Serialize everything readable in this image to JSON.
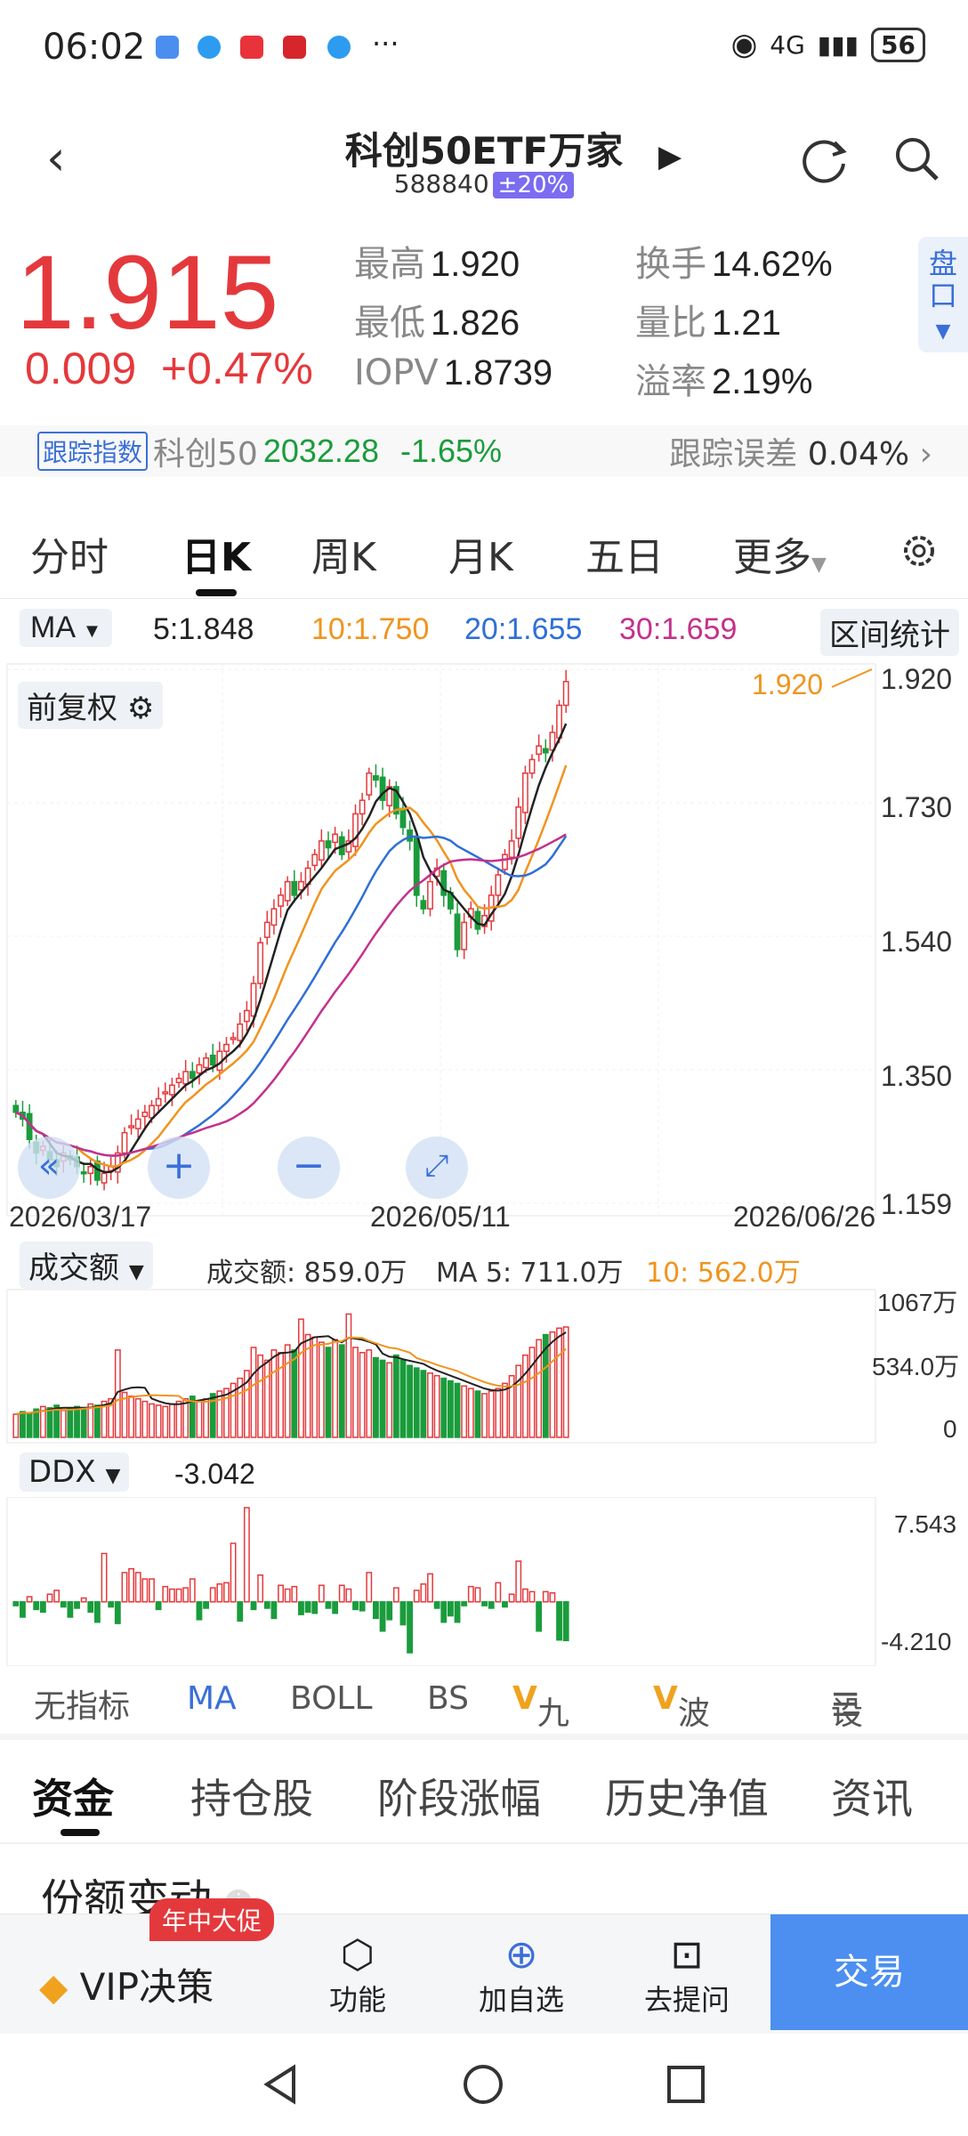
{
  "status_bar": {
    "time": "06:02",
    "more": "···",
    "network": "4G",
    "battery": "56"
  },
  "header": {
    "title": "科创50ETF万家",
    "code": "588840",
    "limit_badge": "±20%"
  },
  "quote": {
    "price": "1.915",
    "change": "0.009",
    "change_pct": "+0.47%",
    "stats": [
      {
        "label": "最高",
        "value": "1.920"
      },
      {
        "label": "换手",
        "value": "14.62%"
      },
      {
        "label": "最低",
        "value": "1.826"
      },
      {
        "label": "量比",
        "value": "1.21"
      },
      {
        "label": "IOPV",
        "value": "1.8739"
      },
      {
        "label": "溢率",
        "value": "2.19%"
      }
    ],
    "pan_label": "盘口"
  },
  "index_bar": {
    "tag": "跟踪指数",
    "index_name": "科创50",
    "index_value": "2032.28",
    "index_change": "-1.65%",
    "error_label": "跟踪误差",
    "error_value": "0.04%"
  },
  "period_tabs": [
    "分时",
    "日K",
    "周K",
    "月K",
    "五日",
    "更多"
  ],
  "ma_row": {
    "selector": "MA",
    "ma5": "5:1.848",
    "ma10": "10:1.750",
    "ma20": "20:1.655",
    "ma30": "30:1.659",
    "range_stats": "区间统计",
    "colors": {
      "ma5": "#222222",
      "ma10": "#f0941e",
      "ma20": "#2f6fd6",
      "ma30": "#c4318c",
      "up": "#e4393c",
      "down": "#1a9c3c"
    }
  },
  "kline": {
    "adjust_label": "前复权",
    "price_axis": [
      "1.920",
      "1.730",
      "1.540",
      "1.350",
      "1.159"
    ],
    "date_axis": [
      "2026/03/17",
      "2026/05/11",
      "2026/06/26"
    ],
    "high_marker": "1.920"
  },
  "volume": {
    "selector": "成交额",
    "text": "成交额: 859.0万",
    "ma5": "MA 5: 711.0万",
    "ma10": "10: 562.0万",
    "axis": [
      "1067万",
      "534.0万",
      "0"
    ]
  },
  "ddx": {
    "selector": "DDX",
    "value": "-3.042",
    "axis": [
      "7.543",
      "-4.210"
    ]
  },
  "indicator_tabs": [
    "无指标",
    "MA",
    "BOLL",
    "BS",
    "九转",
    "波段王",
    "设置"
  ],
  "section_tabs": [
    "资金",
    "持仓股",
    "阶段涨幅",
    "历史净值",
    "资讯"
  ],
  "section_title": "份额变动",
  "bottom_bar": {
    "promo_badge": "年中大促",
    "vip": "VIP决策",
    "items": [
      "功能",
      "加自选",
      "去提问"
    ],
    "trade": "交易"
  },
  "chart_data": {
    "type": "candlestick",
    "x_start": "2026/03/17",
    "x_end": "2026/06/26",
    "ylim": [
      1.159,
      1.92
    ],
    "close": [
      1.28,
      1.27,
      1.24,
      1.22,
      1.23,
      1.21,
      1.2,
      1.22,
      1.21,
      1.2,
      1.19,
      1.2,
      1.18,
      1.19,
      1.2,
      1.22,
      1.25,
      1.26,
      1.27,
      1.28,
      1.29,
      1.3,
      1.31,
      1.32,
      1.33,
      1.34,
      1.33,
      1.35,
      1.36,
      1.35,
      1.37,
      1.38,
      1.39,
      1.41,
      1.43,
      1.47,
      1.53,
      1.56,
      1.58,
      1.6,
      1.62,
      1.6,
      1.62,
      1.64,
      1.66,
      1.68,
      1.67,
      1.69,
      1.66,
      1.68,
      1.72,
      1.74,
      1.78,
      1.77,
      1.74,
      1.76,
      1.72,
      1.7,
      1.68,
      1.6,
      1.58,
      1.62,
      1.64,
      1.6,
      1.58,
      1.52,
      1.56,
      1.58,
      1.55,
      1.57,
      1.6,
      1.63,
      1.66,
      1.68,
      1.73,
      1.78,
      1.8,
      1.82,
      1.81,
      1.84,
      1.88,
      1.915
    ],
    "volume_wan": [
      180,
      200,
      190,
      220,
      240,
      230,
      250,
      210,
      220,
      240,
      230,
      260,
      250,
      280,
      300,
      680,
      350,
      320,
      300,
      280,
      260,
      250,
      240,
      260,
      280,
      300,
      320,
      280,
      300,
      340,
      360,
      380,
      420,
      460,
      520,
      700,
      640,
      600,
      680,
      660,
      720,
      680,
      920,
      800,
      780,
      740,
      700,
      760,
      720,
      960,
      700,
      660,
      680,
      620,
      600,
      580,
      640,
      600,
      560,
      540,
      520,
      500,
      480,
      460,
      440,
      420,
      400,
      380,
      360,
      340,
      360,
      380,
      420,
      480,
      560,
      640,
      700,
      760,
      800,
      820,
      850,
      859
    ],
    "ddx": [
      -0.3,
      -1.2,
      0.4,
      -0.6,
      -0.8,
      0.6,
      0.9,
      -0.4,
      -1.2,
      -0.5,
      0.3,
      -0.8,
      -1.6,
      3.8,
      -0.4,
      -1.7,
      2.3,
      2.6,
      2.3,
      1.8,
      1.8,
      -0.6,
      1.2,
      1.0,
      1.0,
      1.1,
      1.8,
      -1.4,
      -0.5,
      1.1,
      1.4,
      1.5,
      4.6,
      -1.5,
      7.4,
      -0.6,
      2.1,
      -0.5,
      -1.3,
      1.3,
      1.0,
      1.2,
      -1.0,
      -0.8,
      -0.9,
      1.3,
      -0.5,
      -0.9,
      1.3,
      1.0,
      -0.6,
      -0.7,
      2.3,
      -1.3,
      -2.3,
      -1.4,
      1.1,
      -1.8,
      -4.0,
      0.9,
      1.4,
      2.2,
      -0.5,
      -1.6,
      -1.1,
      -1.6,
      -0.3,
      1.2,
      1.1,
      -0.3,
      -0.5,
      1.5,
      -0.4,
      0.6,
      3.2,
      1.0,
      0.8,
      -2.3,
      0.8,
      0.7,
      -3.0,
      -3.042
    ]
  }
}
